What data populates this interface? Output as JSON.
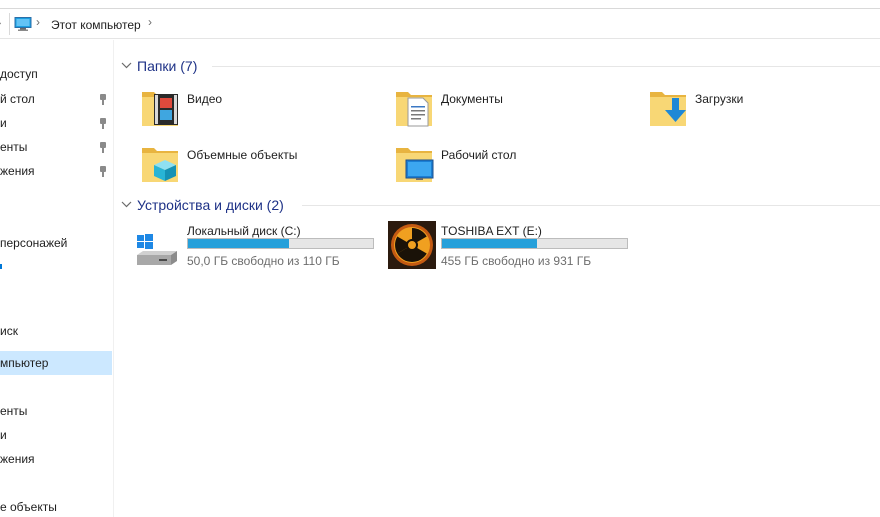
{
  "address_bar": {
    "location": "Этот компьютер"
  },
  "sidebar": {
    "items": [
      {
        "label": "доступ"
      },
      {
        "label": "й стол"
      },
      {
        "label": "и"
      },
      {
        "label": "енты"
      },
      {
        "label": "жения"
      },
      {
        "label": "персонажей"
      },
      {
        "label": "иск"
      },
      {
        "label": "мпьютер"
      },
      {
        "label": "енты"
      },
      {
        "label": "и"
      },
      {
        "label": "жения"
      },
      {
        "label": "е объекты"
      }
    ]
  },
  "folders_group": {
    "title": "Папки (7)",
    "items": [
      {
        "label": "Видео",
        "icon": "video-folder-icon"
      },
      {
        "label": "Документы",
        "icon": "documents-folder-icon"
      },
      {
        "label": "Загрузки",
        "icon": "downloads-folder-icon"
      },
      {
        "label": "Объемные объекты",
        "icon": "3d-objects-folder-icon"
      },
      {
        "label": "Рабочий стол",
        "icon": "desktop-folder-icon"
      }
    ]
  },
  "devices_group": {
    "title": "Устройства и диски (2)",
    "drives": [
      {
        "name": "Локальный диск (C:)",
        "free_text": "50,0 ГБ свободно из 110 ГБ",
        "used_fraction": 0.545
      },
      {
        "name": "TOSHIBA EXT (E:)",
        "free_text": "455 ГБ свободно из 931 ГБ",
        "used_fraction": 0.511
      }
    ]
  },
  "colors": {
    "group_header": "#1e3287",
    "selected_bg": "#cce8ff",
    "usage_bar": "#26a0da",
    "folder_yellow": "#f8d775"
  }
}
